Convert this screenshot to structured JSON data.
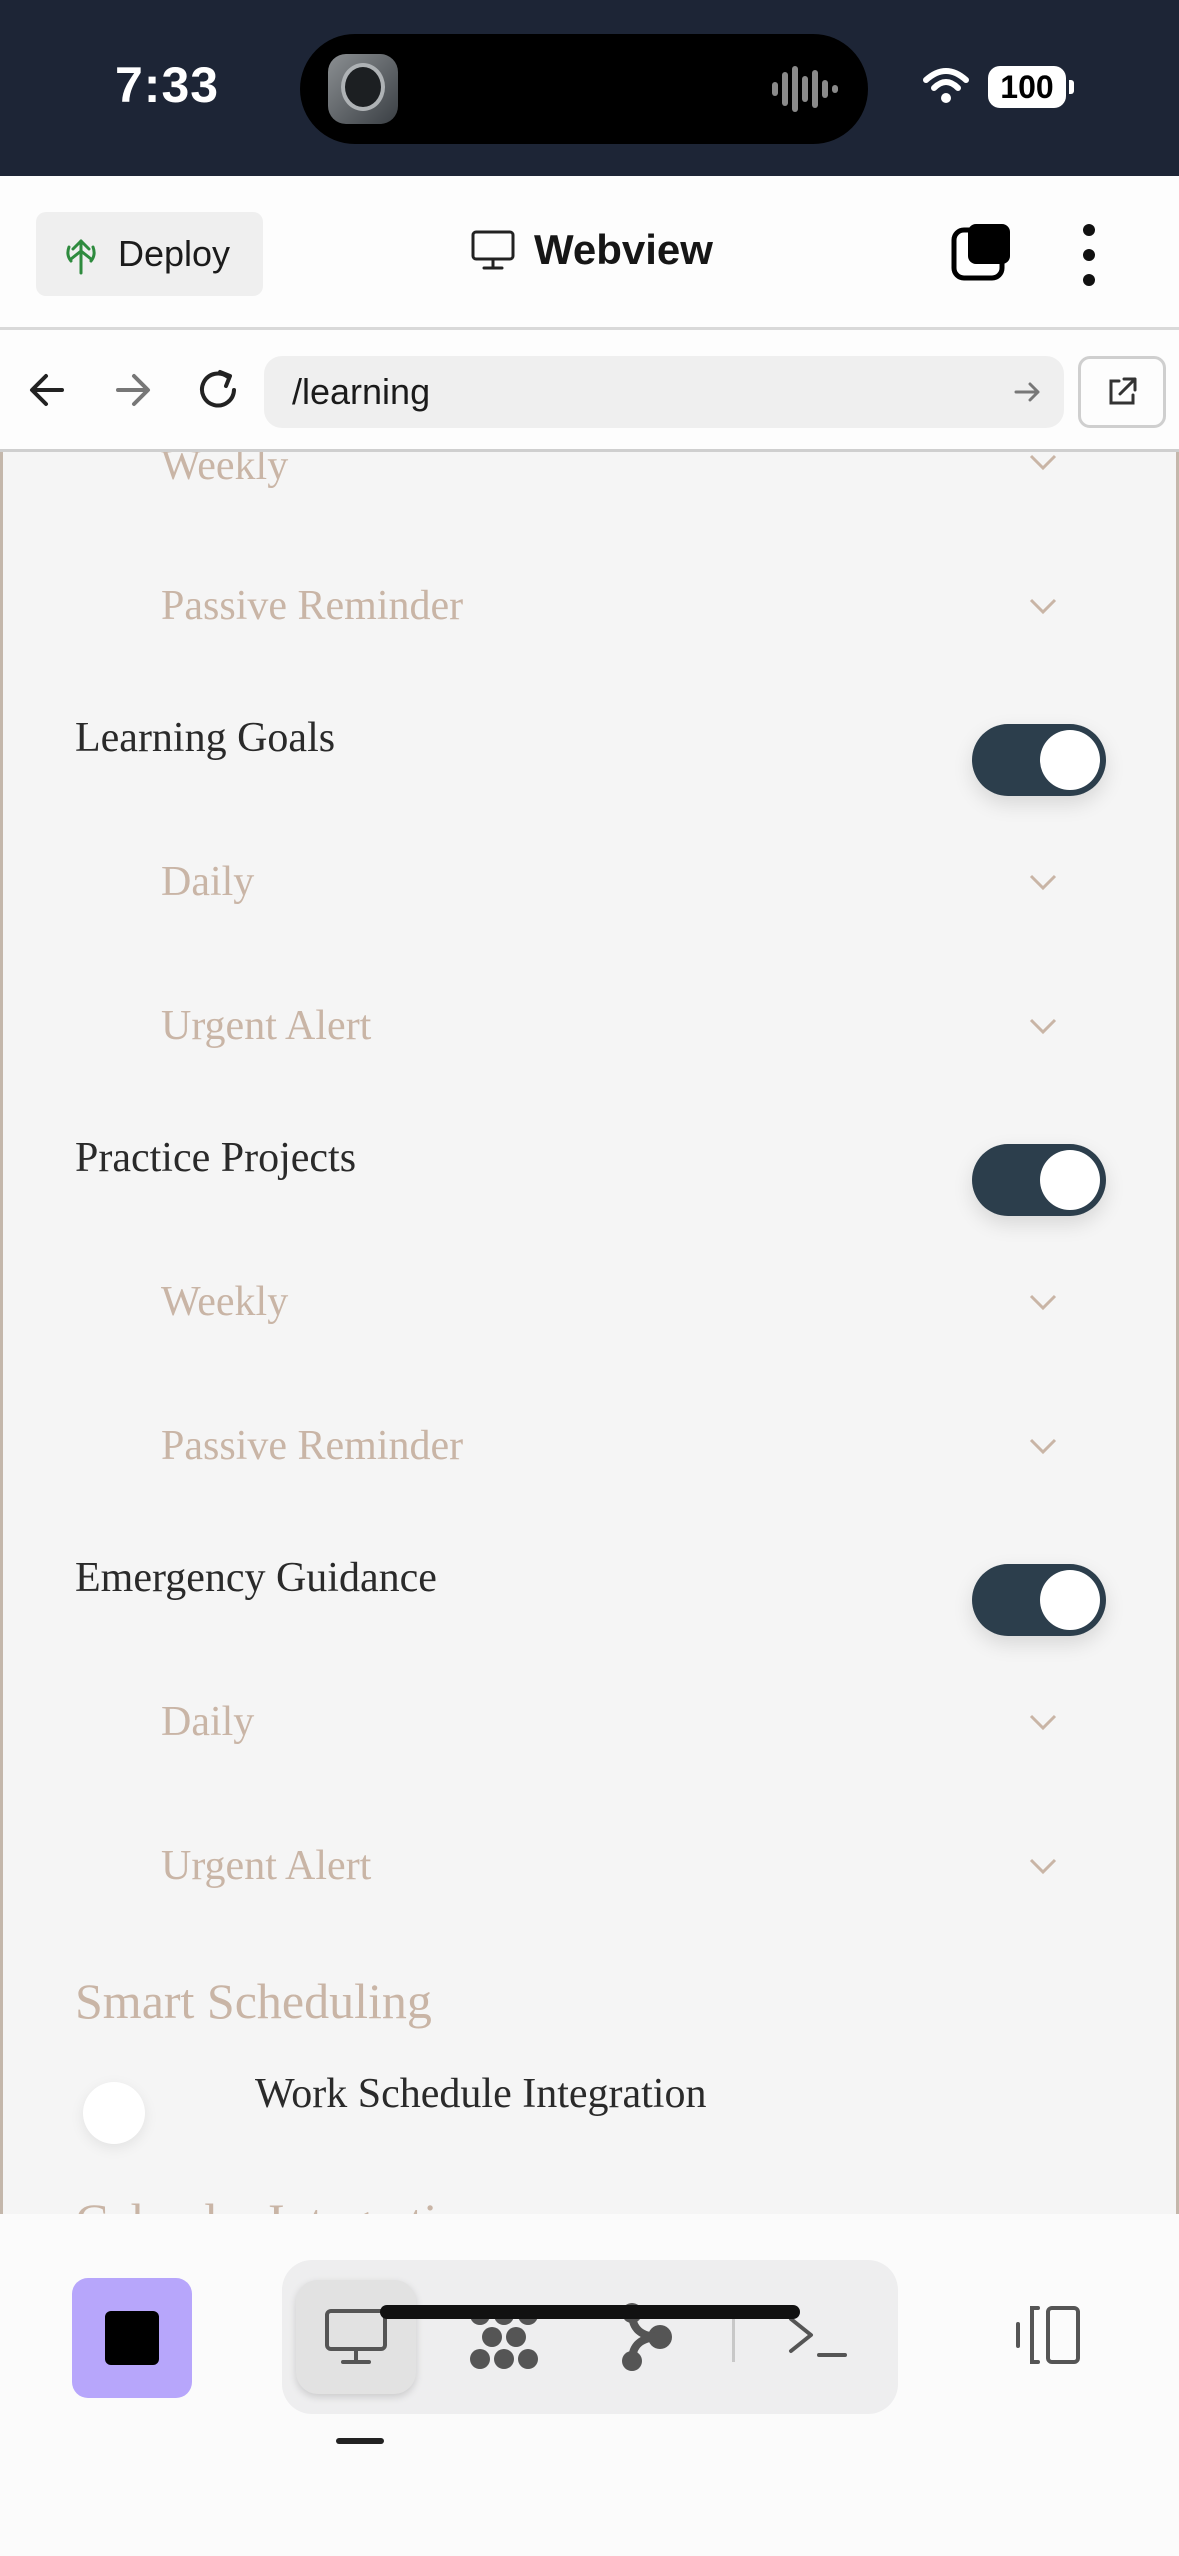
{
  "status_bar": {
    "time": "7:33",
    "battery": "100"
  },
  "header": {
    "deploy_label": "Deploy",
    "title": "Webview"
  },
  "url_bar": {
    "path": "/learning"
  },
  "content": {
    "top_partial": "Weekly",
    "items": [
      {
        "label": "Passive Reminder"
      },
      {
        "label": "Learning Goals",
        "enabled": true
      },
      {
        "label": "Daily"
      },
      {
        "label": "Urgent Alert"
      },
      {
        "label": "Practice Projects",
        "enabled": true
      },
      {
        "label": "Weekly"
      },
      {
        "label": "Passive Reminder"
      },
      {
        "label": "Emergency Guidance",
        "enabled": true
      },
      {
        "label": "Daily"
      },
      {
        "label": "Urgent Alert"
      }
    ],
    "section_title": "Smart Scheduling",
    "work_schedule_label": "Work Schedule Integration",
    "cut_title": "Calendar Integration"
  },
  "colors": {
    "status_bar_bg": "#1d2536",
    "toggle_on": "#2c3e4c",
    "muted_text": "#c9b5a6",
    "stop_button": "#b7a6fb"
  }
}
